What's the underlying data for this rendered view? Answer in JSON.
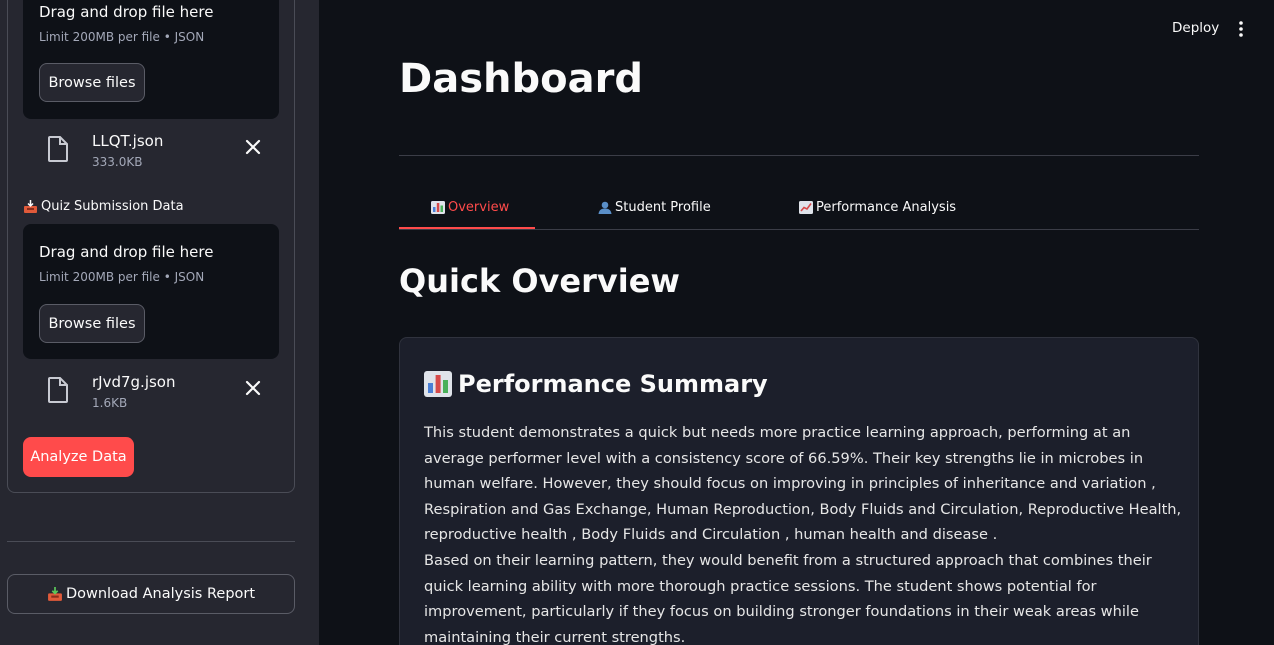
{
  "sidebar": {
    "upload1": {
      "drag_text": "Drag and drop file here",
      "limit_text": "Limit 200MB per file • JSON",
      "browse_label": "Browse files",
      "file_name": "LLQT.json",
      "file_size": "333.0KB"
    },
    "quiz_label": "Quiz Submission Data",
    "quiz_label_icon": "inbox-tray-icon",
    "upload2": {
      "drag_text": "Drag and drop file here",
      "limit_text": "Limit 200MB per file • JSON",
      "browse_label": "Browse files",
      "file_name": "rJvd7g.json",
      "file_size": "1.6KB"
    },
    "analyze_label": "Analyze Data",
    "download_label": "Download Analysis Report",
    "download_icon": "inbox-tray-icon"
  },
  "header": {
    "deploy_label": "Deploy"
  },
  "main": {
    "title": "Dashboard",
    "tabs": [
      {
        "label": "Overview",
        "icon": "bar-chart-icon",
        "active": true
      },
      {
        "label": "Student Profile",
        "icon": "person-icon",
        "active": false
      },
      {
        "label": "Performance Analysis",
        "icon": "trend-up-icon",
        "active": false
      }
    ],
    "section_title": "Quick Overview",
    "card": {
      "title": "Performance Summary",
      "title_icon": "bar-chart-icon",
      "paragraph1": "This student demonstrates a quick but needs more practice learning approach, performing at an average performer level with a consistency score of 66.59%. Their key strengths lie in microbes in human welfare. However, they should focus on improving in principles of inheritance and variation , Respiration and Gas Exchange, Human Reproduction, Body Fluids and Circulation, Reproductive Health, reproductive health , Body Fluids and Circulation , human health and disease .",
      "paragraph2": "Based on their learning pattern, they would benefit from a structured approach that combines their quick learning ability with more thorough practice sessions. The student shows potential for improvement, particularly if they focus on building stronger foundations in their weak areas while maintaining their current strengths."
    }
  },
  "colors": {
    "accent": "#ff4b4b",
    "background": "#0e1117",
    "sidebar": "#262730",
    "card": "#1c1f2b"
  }
}
